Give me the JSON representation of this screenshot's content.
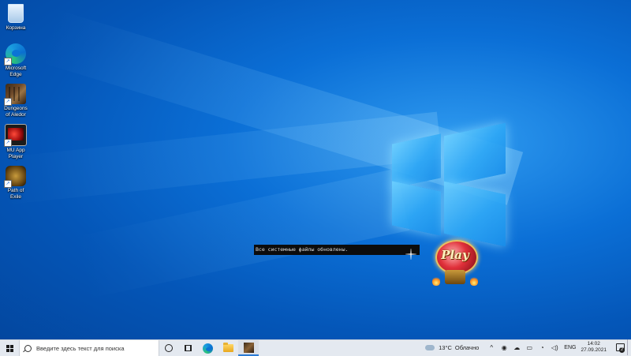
{
  "desktop": {
    "icons": [
      {
        "label": "Корзина",
        "icon": "recycle-bin-icon"
      },
      {
        "label": "Microsoft Edge",
        "icon": "edge-icon"
      },
      {
        "label": "Dungeons of Aledor",
        "icon": "dungeons-icon"
      },
      {
        "label": "MU App Player",
        "icon": "mu-app-player-icon"
      },
      {
        "label": "Path of Exile",
        "icon": "path-of-exile-icon"
      }
    ],
    "console_message": "Все системные файлы обновлены.",
    "play_widget_label": "Play"
  },
  "taskbar": {
    "search_placeholder": "Введите здесь текст для поиска",
    "pinned_apps": [
      "edge-icon",
      "file-explorer-icon",
      "dungeons-icon"
    ],
    "weather_temp": "13°C",
    "weather_desc": "Облачно",
    "language": "ENG",
    "time": "14:02",
    "date": "27.09.2021",
    "notification_count": "2"
  },
  "colors": {
    "wallpaper_accent": "#0b6fd6",
    "taskbar_bg": "#e4e9f0",
    "active_indicator": "#2b7bd6"
  }
}
